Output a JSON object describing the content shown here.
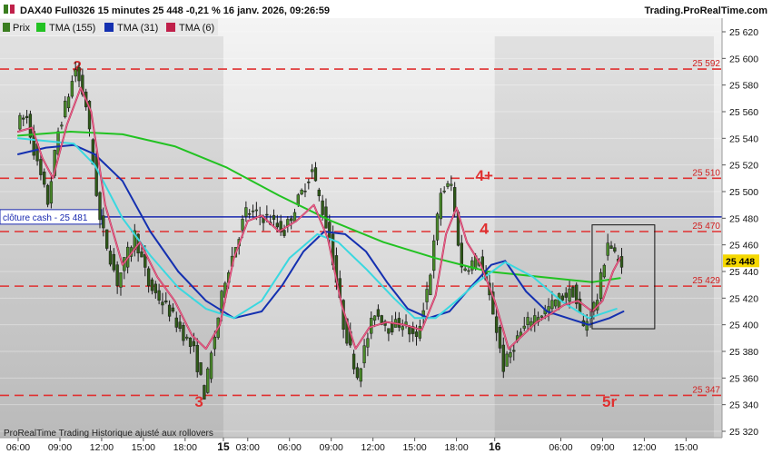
{
  "header": {
    "title": "DAX40 Full0326 15 minutes 25 448 -0,21 % 16 janv. 2026, 09:26:59",
    "brand": "Trading.ProRealTime.com"
  },
  "legend": [
    {
      "label": "Prix",
      "color": "#3a7d1f",
      "icon": "candles-icon"
    },
    {
      "label": "TMA (155)",
      "color": "#22c222"
    },
    {
      "label": "TMA (31)",
      "color": "#1430b0"
    },
    {
      "label": "TMA (6)",
      "color": "#c0204a"
    }
  ],
  "footer": "ProRealTime Trading  Historique ajusté aux rollovers",
  "chart_data": {
    "type": "candlestick",
    "ylim": [
      25310,
      25630
    ],
    "y_ticks": [
      "25 620",
      "25 600",
      "25 580",
      "25 560",
      "25 540",
      "25 520",
      "25 500",
      "25 480",
      "25 460",
      "25 440",
      "25 420",
      "25 400",
      "25 380",
      "25 360",
      "25 340",
      "25 320"
    ],
    "x_ticks": [
      {
        "label": "06:00",
        "bar": 0,
        "bold": false
      },
      {
        "label": "09:00",
        "bar": 12,
        "bold": false
      },
      {
        "label": "12:00",
        "bar": 24,
        "bold": false
      },
      {
        "label": "15:00",
        "bar": 36,
        "bold": false
      },
      {
        "label": "18:00",
        "bar": 48,
        "bold": false
      },
      {
        "label": "15",
        "bar": 59,
        "bold": true
      },
      {
        "label": "03:00",
        "bar": 66,
        "bold": false
      },
      {
        "label": "06:00",
        "bar": 78,
        "bold": false
      },
      {
        "label": "09:00",
        "bar": 90,
        "bold": false
      },
      {
        "label": "12:00",
        "bar": 102,
        "bold": false
      },
      {
        "label": "15:00",
        "bar": 114,
        "bold": false
      },
      {
        "label": "18:00",
        "bar": 126,
        "bold": false
      },
      {
        "label": "16",
        "bar": 137,
        "bold": true
      },
      {
        "label": "06:00",
        "bar": 156,
        "bold": false
      },
      {
        "label": "09:00",
        "bar": 168,
        "bold": false
      },
      {
        "label": "12:00",
        "bar": 180,
        "bold": false
      },
      {
        "label": "15:00",
        "bar": 192,
        "bold": false
      }
    ],
    "bar_count": 200,
    "last_visible_bar": 170,
    "current_price": {
      "label": "25 448",
      "value": 25448,
      "color": "#f5d800"
    },
    "cash_close": {
      "label": "clôture cash -  25 481",
      "value": 25481,
      "color": "#1a2ab0"
    },
    "levels": [
      {
        "value": 25592,
        "label": "25 592",
        "marker": "2",
        "marker_bar": 17
      },
      {
        "value": 25510,
        "label": "25 510",
        "marker": "4+",
        "marker_bar": 134
      },
      {
        "value": 25470,
        "label": "25 470",
        "marker": "4",
        "marker_bar": 134
      },
      {
        "value": 25429,
        "label": "25 429",
        "marker": "",
        "marker_bar": 0
      },
      {
        "value": 25347,
        "label": "25 347",
        "marker": "3",
        "marker_bar": 52
      },
      {
        "value": 25347,
        "label": "",
        "marker": "5r",
        "marker_bar": 170
      }
    ],
    "box": {
      "bar_start": 165,
      "bar_end": 183,
      "y_high": 25475,
      "y_low": 25397
    },
    "pivots": [
      [
        0,
        25552
      ],
      [
        3,
        25555
      ],
      [
        6,
        25520
      ],
      [
        9,
        25492
      ],
      [
        12,
        25545
      ],
      [
        17,
        25592
      ],
      [
        20,
        25565
      ],
      [
        24,
        25478
      ],
      [
        29,
        25432
      ],
      [
        34,
        25468
      ],
      [
        38,
        25430
      ],
      [
        44,
        25410
      ],
      [
        51,
        25380
      ],
      [
        54,
        25348
      ],
      [
        60,
        25435
      ],
      [
        66,
        25485
      ],
      [
        72,
        25480
      ],
      [
        77,
        25470
      ],
      [
        80,
        25488
      ],
      [
        85,
        25516
      ],
      [
        90,
        25465
      ],
      [
        94,
        25400
      ],
      [
        98,
        25362
      ],
      [
        103,
        25410
      ],
      [
        107,
        25398
      ],
      [
        111,
        25402
      ],
      [
        115,
        25388
      ],
      [
        119,
        25440
      ],
      [
        122,
        25500
      ],
      [
        125,
        25505
      ],
      [
        128,
        25442
      ],
      [
        133,
        25450
      ],
      [
        137,
        25410
      ],
      [
        140,
        25368
      ],
      [
        144,
        25390
      ],
      [
        148,
        25405
      ],
      [
        152,
        25410
      ],
      [
        156,
        25420
      ],
      [
        160,
        25425
      ],
      [
        163,
        25398
      ],
      [
        167,
        25420
      ],
      [
        170,
        25463
      ],
      [
        172,
        25452
      ],
      [
        173,
        25448
      ]
    ],
    "series": [
      {
        "name": "TMA (155)",
        "color": "#22c222",
        "points": [
          [
            0,
            25542
          ],
          [
            15,
            25545
          ],
          [
            30,
            25543
          ],
          [
            45,
            25534
          ],
          [
            60,
            25518
          ],
          [
            75,
            25497
          ],
          [
            90,
            25478
          ],
          [
            105,
            25462
          ],
          [
            120,
            25450
          ],
          [
            135,
            25440
          ],
          [
            150,
            25436
          ],
          [
            165,
            25432
          ],
          [
            173,
            25435
          ]
        ]
      },
      {
        "name": "TMA (31)",
        "color": "#1430b0",
        "points": [
          [
            0,
            25528
          ],
          [
            8,
            25533
          ],
          [
            16,
            25535
          ],
          [
            22,
            25528
          ],
          [
            30,
            25508
          ],
          [
            38,
            25470
          ],
          [
            46,
            25440
          ],
          [
            54,
            25418
          ],
          [
            62,
            25405
          ],
          [
            70,
            25410
          ],
          [
            76,
            25430
          ],
          [
            82,
            25455
          ],
          [
            88,
            25470
          ],
          [
            94,
            25468
          ],
          [
            100,
            25455
          ],
          [
            106,
            25432
          ],
          [
            112,
            25412
          ],
          [
            118,
            25405
          ],
          [
            124,
            25410
          ],
          [
            130,
            25428
          ],
          [
            136,
            25445
          ],
          [
            140,
            25448
          ],
          [
            146,
            25425
          ],
          [
            152,
            25410
          ],
          [
            158,
            25405
          ],
          [
            164,
            25400
          ],
          [
            170,
            25405
          ],
          [
            174,
            25410
          ]
        ]
      },
      {
        "name": "TMA (31) early",
        "color": "#3ad8e0",
        "points": [
          [
            0,
            25540
          ],
          [
            8,
            25538
          ],
          [
            16,
            25536
          ],
          [
            22,
            25520
          ],
          [
            30,
            25480
          ],
          [
            38,
            25452
          ],
          [
            46,
            25428
          ],
          [
            54,
            25412
          ],
          [
            62,
            25405
          ],
          [
            70,
            25418
          ],
          [
            78,
            25450
          ],
          [
            86,
            25468
          ],
          [
            92,
            25462
          ],
          [
            100,
            25442
          ],
          [
            108,
            25420
          ],
          [
            114,
            25405
          ],
          [
            120,
            25405
          ],
          [
            126,
            25418
          ],
          [
            132,
            25432
          ],
          [
            140,
            25447
          ],
          [
            148,
            25436
          ],
          [
            156,
            25418
          ],
          [
            164,
            25405
          ],
          [
            172,
            25412
          ]
        ]
      },
      {
        "name": "TMA (6)",
        "color": "#c0204a",
        "points": [
          [
            0,
            25545
          ],
          [
            4,
            25548
          ],
          [
            7,
            25525
          ],
          [
            10,
            25510
          ],
          [
            14,
            25550
          ],
          [
            18,
            25578
          ],
          [
            21,
            25560
          ],
          [
            25,
            25490
          ],
          [
            30,
            25445
          ],
          [
            35,
            25462
          ],
          [
            40,
            25436
          ],
          [
            45,
            25418
          ],
          [
            50,
            25392
          ],
          [
            54,
            25382
          ],
          [
            58,
            25400
          ],
          [
            62,
            25450
          ],
          [
            66,
            25478
          ],
          [
            70,
            25482
          ],
          [
            75,
            25470
          ],
          [
            80,
            25478
          ],
          [
            85,
            25490
          ],
          [
            89,
            25465
          ],
          [
            93,
            25415
          ],
          [
            97,
            25382
          ],
          [
            101,
            25398
          ],
          [
            106,
            25402
          ],
          [
            111,
            25400
          ],
          [
            116,
            25396
          ],
          [
            120,
            25422
          ],
          [
            123,
            25468
          ],
          [
            126,
            25488
          ],
          [
            129,
            25462
          ],
          [
            133,
            25445
          ],
          [
            137,
            25418
          ],
          [
            141,
            25382
          ],
          [
            145,
            25392
          ],
          [
            149,
            25402
          ],
          [
            153,
            25408
          ],
          [
            157,
            25415
          ],
          [
            161,
            25418
          ],
          [
            165,
            25410
          ],
          [
            168,
            25418
          ],
          [
            171,
            25440
          ],
          [
            173,
            25450
          ]
        ]
      }
    ]
  }
}
